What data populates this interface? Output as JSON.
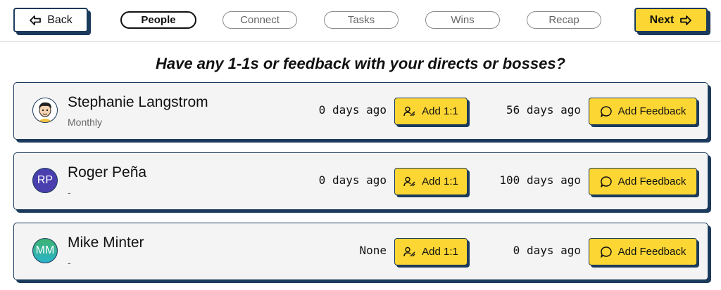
{
  "nav": {
    "back_label": "Back",
    "next_label": "Next",
    "steps": [
      {
        "label": "People",
        "active": true
      },
      {
        "label": "Connect",
        "active": false
      },
      {
        "label": "Tasks",
        "active": false
      },
      {
        "label": "Wins",
        "active": false
      },
      {
        "label": "Recap",
        "active": false
      }
    ]
  },
  "question": "Have any 1-1s or feedback with your directs or bosses?",
  "people": [
    {
      "name": "Stephanie Langstrom",
      "subtitle": "Monthly",
      "avatar": {
        "type": "cartoon-icon",
        "initials": ""
      },
      "last_one_on_one": "0 days ago",
      "one_on_one_button": "Add 1:1",
      "last_feedback": "56 days ago",
      "feedback_button": "Add Feedback"
    },
    {
      "name": "Roger Peña",
      "subtitle": "-",
      "avatar": {
        "type": "initials",
        "initials": "RP",
        "color": "#4a3fae"
      },
      "last_one_on_one": "0 days ago",
      "one_on_one_button": "Add 1:1",
      "last_feedback": "100 days ago",
      "feedback_button": "Add Feedback"
    },
    {
      "name": "Mike Minter",
      "subtitle": "-",
      "avatar": {
        "type": "initials",
        "initials": "MM",
        "color_top": "#3cb371",
        "color_bottom": "#2bb3c9"
      },
      "last_one_on_one": "None",
      "one_on_one_button": "Add 1:1",
      "last_feedback": "0 days ago",
      "feedback_button": "Add Feedback"
    }
  ],
  "colors": {
    "accent_yellow": "#fcd633",
    "border_navy": "#1b3a5c",
    "card_bg": "#f4f4f4"
  }
}
